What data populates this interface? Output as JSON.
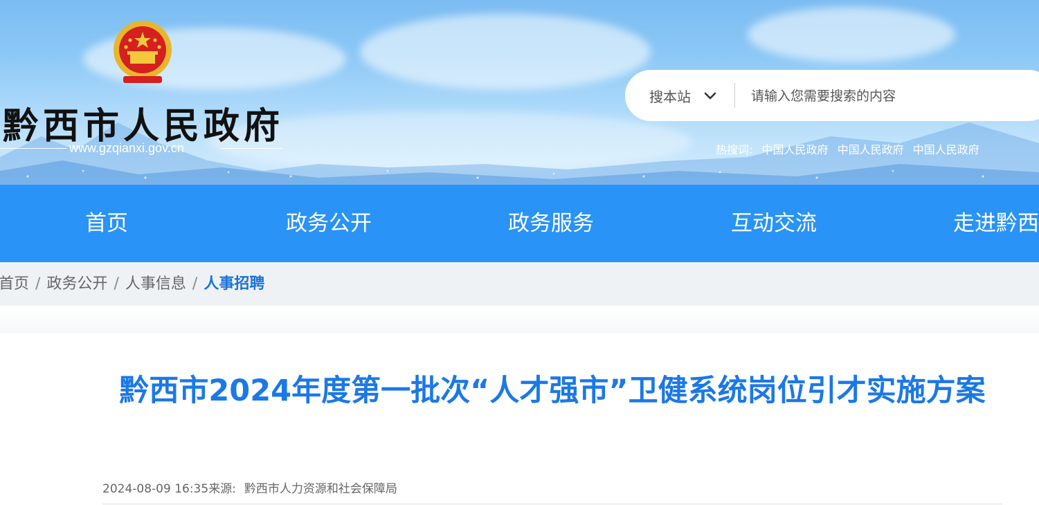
{
  "header": {
    "site_name": "黔西市人民政府",
    "site_url": "www.gzqianxi.gov.cn",
    "emblem_icon": "national-emblem-icon"
  },
  "search": {
    "scope_label": "搜本站",
    "placeholder": "请输入您需要搜索的内容",
    "hot_label": "热搜词:",
    "hot_words": [
      "中国人民政府",
      "中国人民政府",
      "中国人民政府"
    ]
  },
  "nav": {
    "items": [
      "首页",
      "政务公开",
      "政务服务",
      "互动交流",
      "走进黔西"
    ]
  },
  "breadcrumb": {
    "items": [
      "首页",
      "政务公开",
      "人事信息",
      "人事招聘"
    ],
    "separator": "/"
  },
  "article": {
    "title": "黔西市2024年度第一批次“人才强市”卫健系统岗位引才实施方案",
    "datetime": "2024-08-09 16:35",
    "source_label": "来源:",
    "source": "黔西市人力资源和社会保障局"
  },
  "colors": {
    "nav_bg": "#2993f7",
    "title_blue": "#1b78e8",
    "breadcrumb_current": "#1a73d9"
  }
}
